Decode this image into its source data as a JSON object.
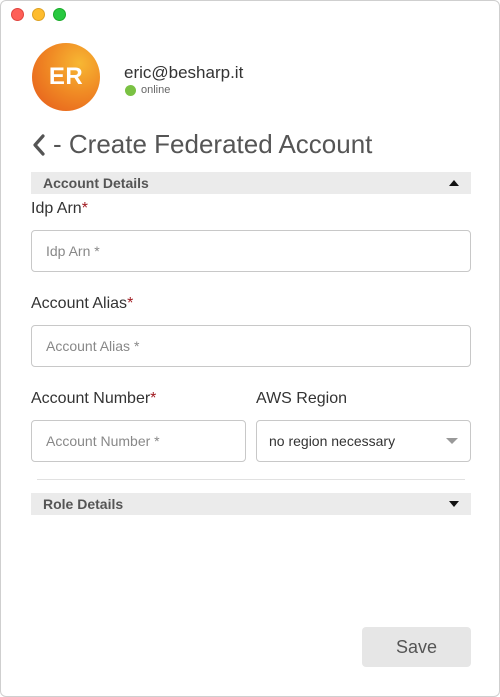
{
  "window": {
    "traffic_lights": [
      "close",
      "minimize",
      "maximize"
    ]
  },
  "user": {
    "initials": "ER",
    "email": "eric@besharp.it",
    "status": "online"
  },
  "page": {
    "title": "- Create Federated Account"
  },
  "sections": {
    "account_details": {
      "label": "Account Details",
      "expanded": true
    },
    "role_details": {
      "label": "Role Details",
      "expanded": false
    }
  },
  "form": {
    "idp_arn": {
      "label": "Idp Arn",
      "required_mark": "*",
      "value": "",
      "placeholder": "Idp Arn *"
    },
    "account_alias": {
      "label": "Account Alias",
      "required_mark": "*",
      "value": "",
      "placeholder": "Account Alias *"
    },
    "account_number": {
      "label": "Account Number",
      "required_mark": "*",
      "value": "",
      "placeholder": "Account Number *"
    },
    "aws_region": {
      "label": "AWS Region",
      "selected": "no region necessary"
    }
  },
  "actions": {
    "save_label": "Save"
  },
  "colors": {
    "required": "#a0191f",
    "status_online": "#7ac143",
    "section_header_bg": "#ebebeb",
    "save_bg": "#e6e6e6"
  }
}
